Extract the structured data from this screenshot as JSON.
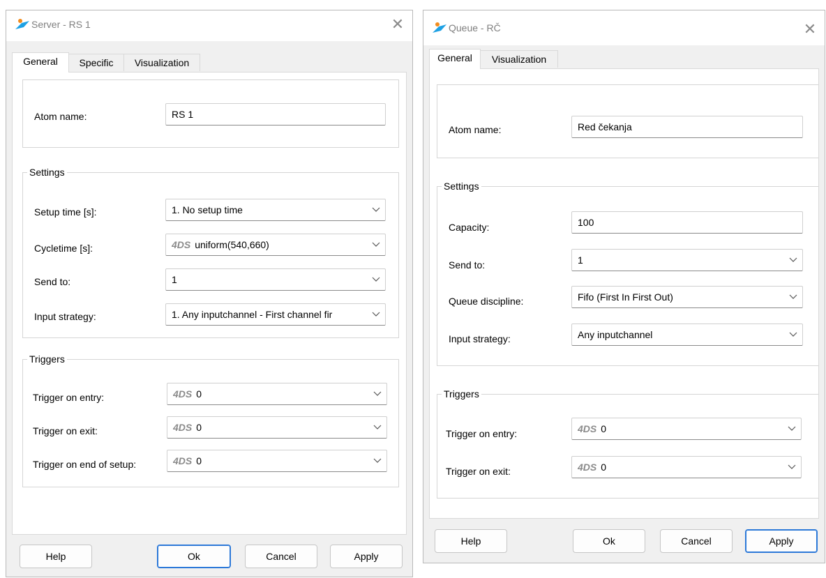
{
  "server": {
    "title": "Server - RS 1",
    "close": "✕",
    "tabs": [
      "General",
      "Specific",
      "Visualization"
    ],
    "atom_name_label": "Atom name:",
    "atom_name_value": "RS 1",
    "settings_title": "Settings",
    "setup_time_label": "Setup time [s]:",
    "setup_time_value": "1. No setup time",
    "cycletime_label": "Cycletime [s]:",
    "cycletime_prefix": "4DS",
    "cycletime_value": "uniform(540,660)",
    "send_to_label": "Send to:",
    "send_to_value": "1",
    "input_strategy_label": "Input strategy:",
    "input_strategy_value": "1. Any inputchannel -  First channel fir",
    "triggers_title": "Triggers",
    "trigger_entry_label": "Trigger on entry:",
    "trigger_entry_prefix": "4DS",
    "trigger_entry_value": "0",
    "trigger_exit_label": "Trigger on exit:",
    "trigger_exit_prefix": "4DS",
    "trigger_exit_value": "0",
    "trigger_setup_label": "Trigger on end of setup:",
    "trigger_setup_prefix": "4DS",
    "trigger_setup_value": "0",
    "buttons": {
      "help": "Help",
      "ok": "Ok",
      "cancel": "Cancel",
      "apply": "Apply"
    }
  },
  "queue": {
    "title": "Queue - RČ",
    "close": "✕",
    "tabs": [
      "General",
      "Visualization"
    ],
    "atom_name_label": "Atom name:",
    "atom_name_value": "Red čekanja",
    "settings_title": "Settings",
    "capacity_label": "Capacity:",
    "capacity_value": "100",
    "send_to_label": "Send to:",
    "send_to_value": "1",
    "queue_discipline_label": "Queue discipline:",
    "queue_discipline_value": "Fifo (First In First Out)",
    "input_strategy_label": "Input strategy:",
    "input_strategy_value": "Any inputchannel",
    "triggers_title": "Triggers",
    "trigger_entry_label": "Trigger on entry:",
    "trigger_entry_prefix": "4DS",
    "trigger_entry_value": "0",
    "trigger_exit_label": "Trigger on exit:",
    "trigger_exit_prefix": "4DS",
    "trigger_exit_value": "0",
    "buttons": {
      "help": "Help",
      "ok": "Ok",
      "cancel": "Cancel",
      "apply": "Apply"
    }
  },
  "icons": {
    "app": "app-logo-icon",
    "close": "close-icon",
    "dropdown": "chevron-down-icon"
  },
  "colors": {
    "accent": "#2b78d8",
    "logo_blue": "#1ea1e4",
    "logo_orange": "#f28c1e"
  }
}
